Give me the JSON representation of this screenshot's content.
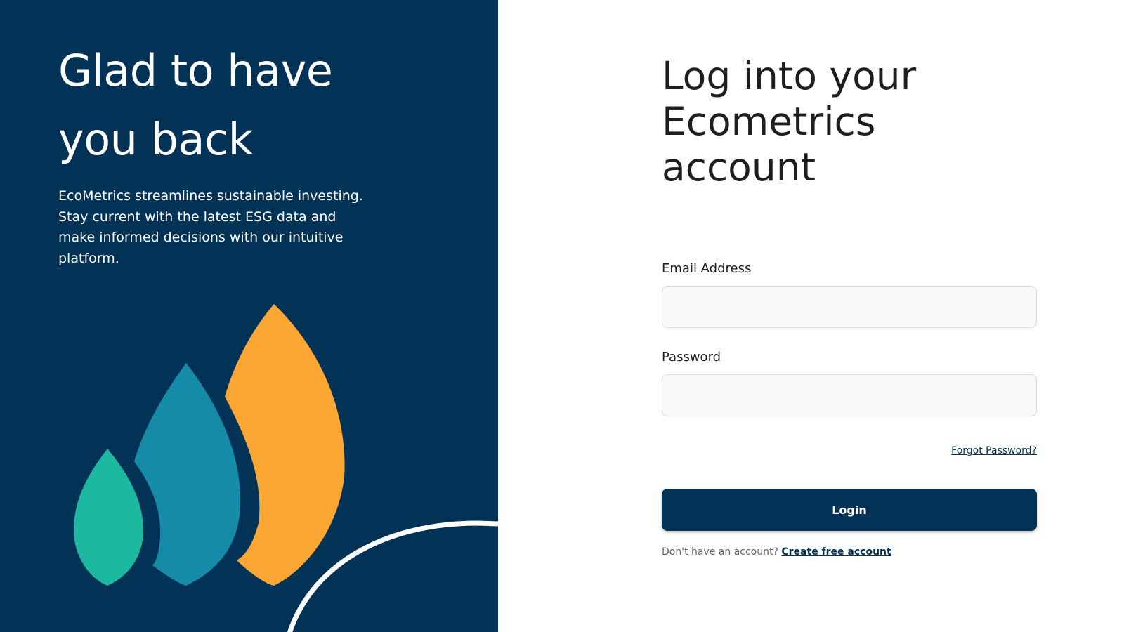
{
  "welcome": {
    "title": "Glad to have you back",
    "description": "EcoMetrics streamlines sustainable investing. Stay current with the latest ESG data and make informed decisions with our intuitive platform."
  },
  "illustration": {
    "icon": "leaf-drops-illustration",
    "colors": {
      "background": "#033257",
      "small_drop": "#1db8a0",
      "medium_drop": "#168ba8",
      "large_drop": "#fca734",
      "arc": "#ffffff"
    }
  },
  "login": {
    "title": "Log into your Ecometrics account",
    "email_label": "Email Address",
    "email_value": "",
    "password_label": "Password",
    "password_value": "",
    "forgot_password": "Forgot Password?",
    "submit_label": "Login",
    "no_account_text": "Don't have an account?",
    "create_account_link": "Create free account"
  },
  "colors": {
    "brand_navy": "#033257",
    "input_background": "#f8f9fb",
    "input_border": "#d6dbe0"
  }
}
